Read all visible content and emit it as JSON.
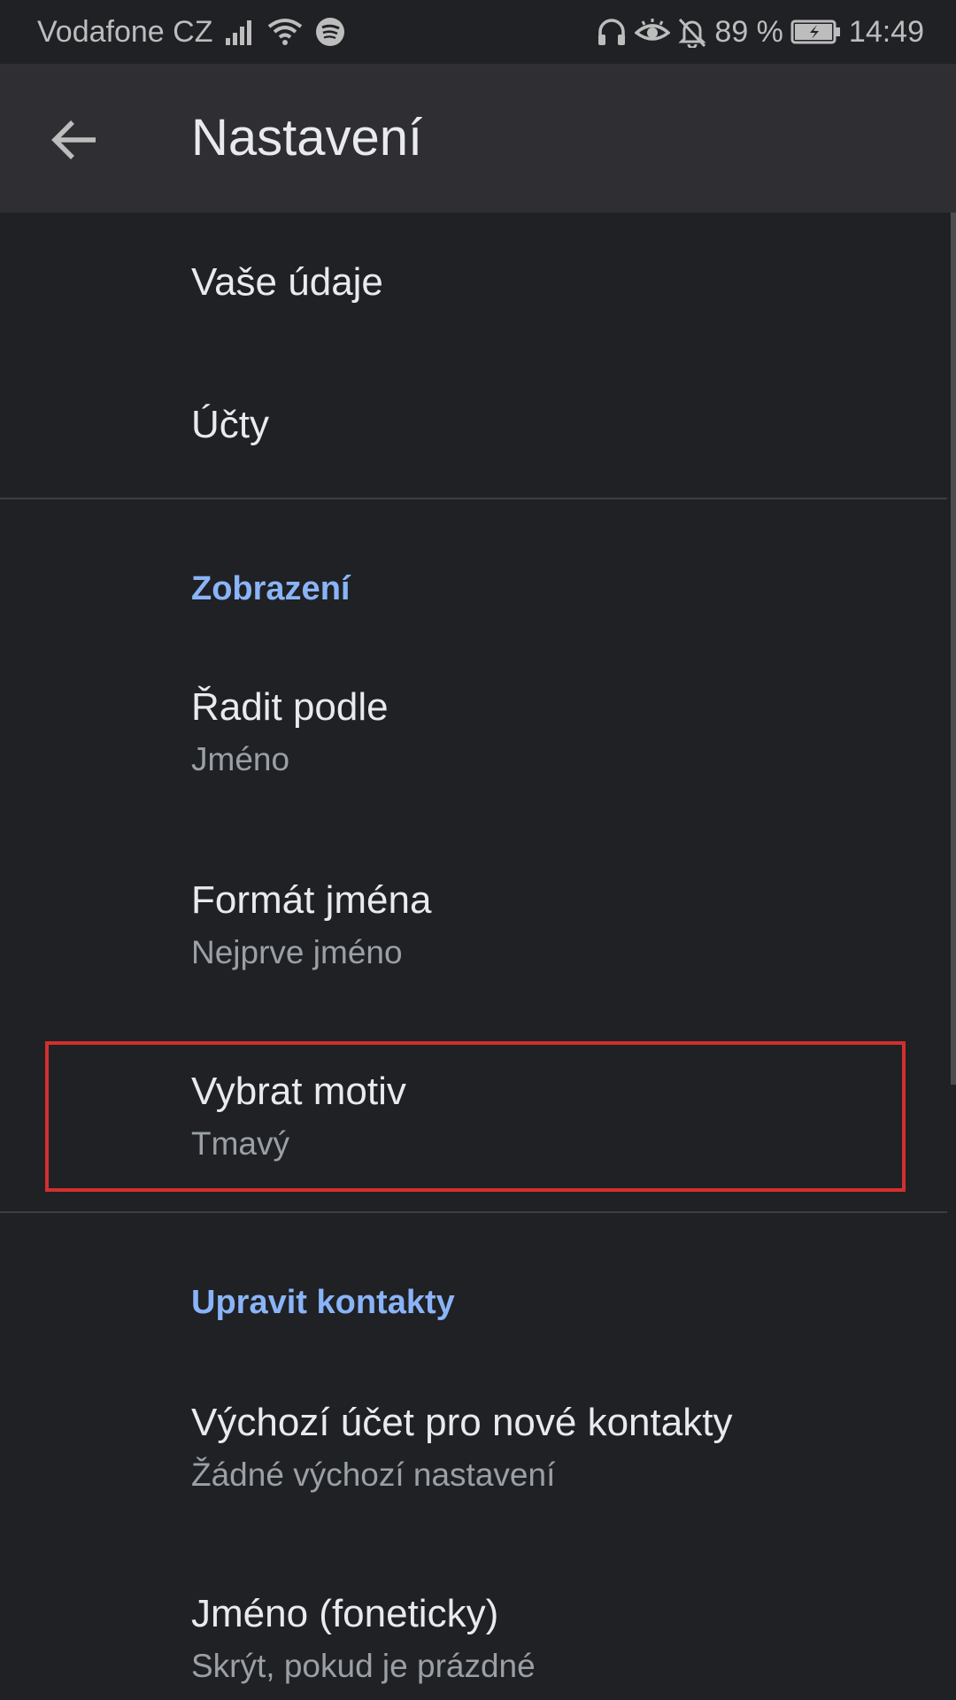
{
  "status_bar": {
    "carrier": "Vodafone CZ",
    "battery_percent": "89 %",
    "time": "14:49",
    "icons": [
      "signal-icon",
      "wifi-icon",
      "spotify-icon",
      "headphones-icon",
      "eye-icon",
      "bell-off-icon",
      "battery-charging-icon"
    ]
  },
  "app_bar": {
    "back_icon": "arrow-back-icon",
    "title": "Nastavení"
  },
  "settings": {
    "your_info": {
      "title": "Vaše údaje"
    },
    "accounts": {
      "title": "Účty"
    },
    "display_section": {
      "header": "Zobrazení"
    },
    "sort_by": {
      "title": "Řadit podle",
      "value": "Jméno"
    },
    "name_format": {
      "title": "Formát jména",
      "value": "Nejprve jméno"
    },
    "choose_theme": {
      "title": "Vybrat motiv",
      "value": "Tmavý"
    },
    "edit_contacts_section": {
      "header": "Upravit kontakty"
    },
    "default_account": {
      "title": "Výchozí účet pro nové kontakty",
      "value": "Žádné výchozí nastavení"
    },
    "phonetic_name": {
      "title": "Jméno (foneticky)",
      "value": "Skrýt, pokud je prázdné"
    }
  },
  "colors": {
    "background": "#202124",
    "app_bar": "#2f2f33",
    "primary_text": "#e8eaed",
    "secondary_text": "#9aa0a6",
    "accent": "#8ab4f8",
    "highlight": "#d32f2f"
  }
}
